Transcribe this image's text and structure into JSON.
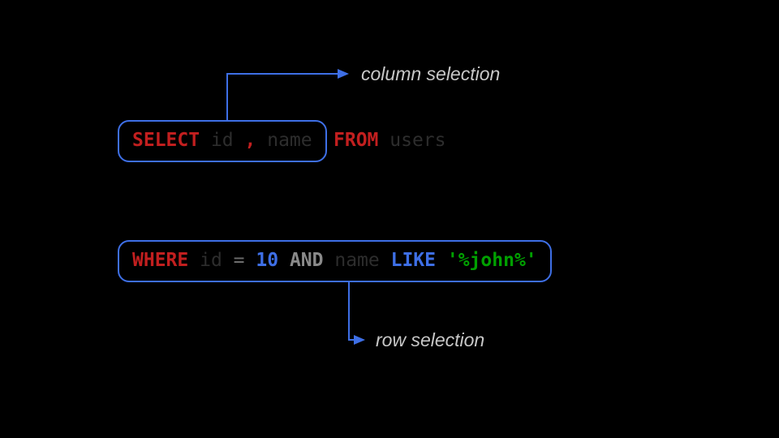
{
  "annotations": {
    "column_selection": "column selection",
    "row_selection": "row selection"
  },
  "sql": {
    "select_kw": "SELECT",
    "col1": "id",
    "comma": ",",
    "col2": "name",
    "from_kw": "FROM",
    "table": "users",
    "where_kw": "WHERE",
    "where_col1": "id",
    "eq": "=",
    "where_val1": "10",
    "and_kw": "AND",
    "where_col2": "name",
    "like_kw": "LIKE",
    "where_val2": "'%john%'"
  },
  "colors": {
    "border": "#3e6fe6",
    "keyword": "#c21f1f",
    "number": "#3e6fe6",
    "string": "#00a000",
    "annotation": "#c8c8c8"
  }
}
